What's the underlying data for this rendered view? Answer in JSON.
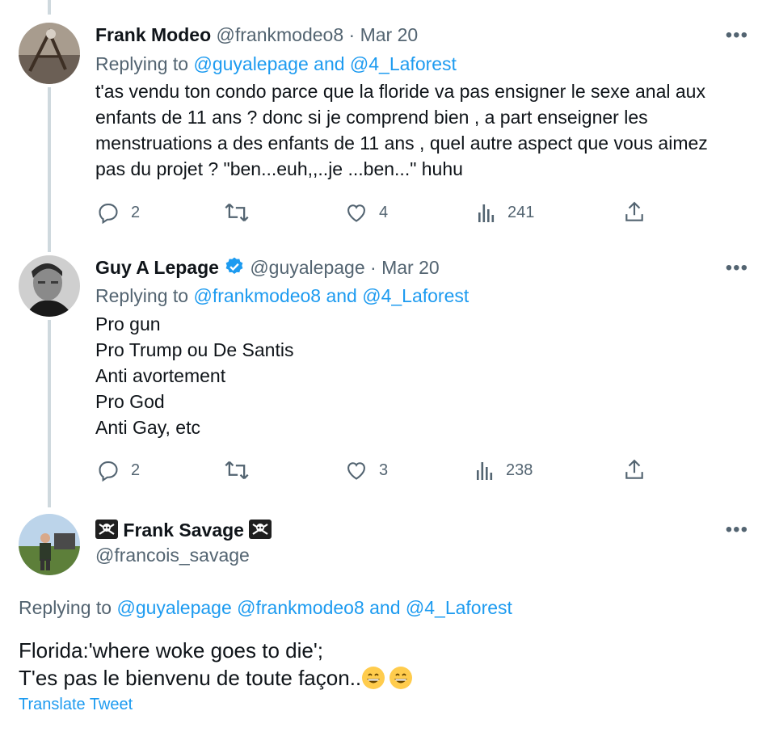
{
  "colors": {
    "accent": "#1d9bf0",
    "secondary_text": "#536471",
    "thread_line": "#cfd9de",
    "verified": "#1d9bf0"
  },
  "tweets": [
    {
      "display_name": "Frank Modeo",
      "handle": "@frankmodeo8",
      "date": "· Mar 20",
      "replying_prefix": "Replying to",
      "replying_to": "@guyalepage and @4_Laforest",
      "lines": [
        "t'as vendu ton condo parce que la floride va pas ensigner le sexe anal aux",
        "enfants de 11 ans ? donc si je comprend bien , a part enseigner les",
        "menstruations a des enfants de 11 ans , quel autre aspect que vous aimez",
        "pas du projet ? \"ben...euh,,..je ...ben...\" huhu"
      ],
      "replies": "2",
      "retweets": "",
      "likes": "4",
      "views": "241"
    },
    {
      "display_name": "Guy A Lepage",
      "handle": "@guyalepage",
      "date": "· Mar 20",
      "replying_prefix": "Replying to",
      "replying_to": "@frankmodeo8 and @4_Laforest",
      "lines": [
        "Pro gun",
        "Pro Trump ou De Santis",
        "Anti avortement",
        "Pro God",
        "Anti Gay, etc"
      ],
      "replies": "2",
      "retweets": "",
      "likes": "3",
      "views": "238"
    },
    {
      "display_name": "Frank Savage",
      "handle": "@francois_savage",
      "replying_prefix": "Replying to",
      "replying_to": "@guyalepage @frankmodeo8 and @4_Laforest",
      "lines": [
        "Florida:'where woke goes to die';",
        "T'es pas le bienvenu de toute façon.."
      ],
      "translate": "Translate Tweet"
    }
  ],
  "icons": [
    "more-icon",
    "reply-icon",
    "retweet-icon",
    "like-icon",
    "views-icon",
    "share-icon",
    "verified-badge-icon",
    "skull-crossbones-icon",
    "grinning-face-icon"
  ]
}
